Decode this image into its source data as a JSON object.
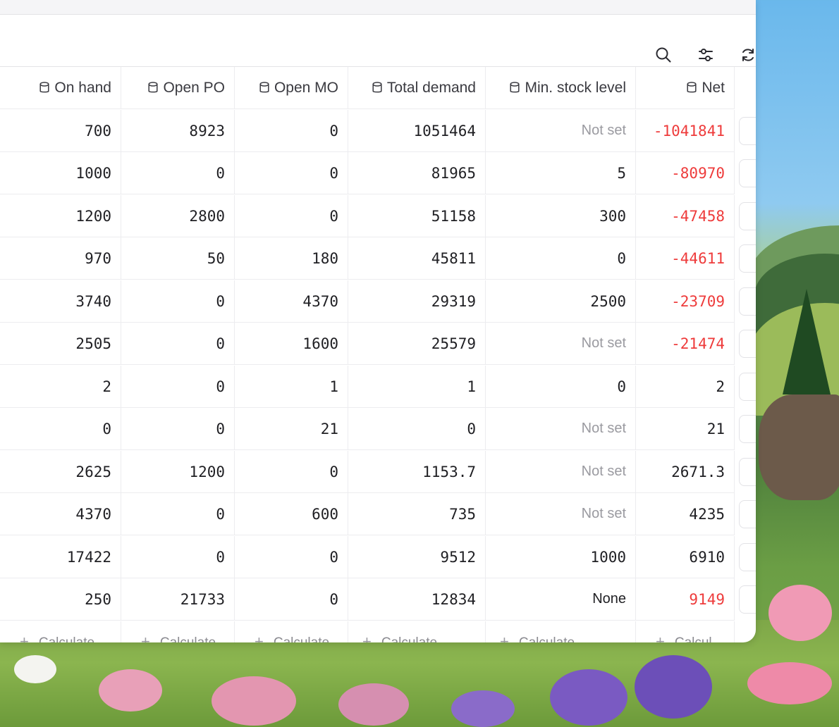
{
  "toolbar": {
    "icons": [
      "search-icon",
      "filter-settings-icon",
      "refresh-icon"
    ]
  },
  "columns": [
    {
      "key": "on_hand",
      "label": "On hand",
      "icon": "database-icon"
    },
    {
      "key": "open_po",
      "label": "Open PO",
      "icon": "database-icon"
    },
    {
      "key": "open_mo",
      "label": "Open MO",
      "icon": "database-icon"
    },
    {
      "key": "total_demand",
      "label": "Total demand",
      "icon": "database-icon"
    },
    {
      "key": "min_stock",
      "label": "Min. stock level",
      "icon": "database-icon"
    },
    {
      "key": "net",
      "label": "Net",
      "icon": "database-icon"
    }
  ],
  "rows": [
    {
      "on_hand": "700",
      "open_po": "8923",
      "open_mo": "0",
      "total_demand": "1051464",
      "min_stock": "Not set",
      "net": "-1041841"
    },
    {
      "on_hand": "1000",
      "open_po": "0",
      "open_mo": "0",
      "total_demand": "81965",
      "min_stock": "5",
      "net": "-80970"
    },
    {
      "on_hand": "1200",
      "open_po": "2800",
      "open_mo": "0",
      "total_demand": "51158",
      "min_stock": "300",
      "net": "-47458"
    },
    {
      "on_hand": "970",
      "open_po": "50",
      "open_mo": "180",
      "total_demand": "45811",
      "min_stock": "0",
      "net": "-44611"
    },
    {
      "on_hand": "3740",
      "open_po": "0",
      "open_mo": "4370",
      "total_demand": "29319",
      "min_stock": "2500",
      "net": "-23709"
    },
    {
      "on_hand": "2505",
      "open_po": "0",
      "open_mo": "1600",
      "total_demand": "25579",
      "min_stock": "Not set",
      "net": "-21474"
    },
    {
      "on_hand": "2",
      "open_po": "0",
      "open_mo": "1",
      "total_demand": "1",
      "min_stock": "0",
      "net": "2"
    },
    {
      "on_hand": "0",
      "open_po": "0",
      "open_mo": "21",
      "total_demand": "0",
      "min_stock": "Not set",
      "net": "21"
    },
    {
      "on_hand": "2625",
      "open_po": "1200",
      "open_mo": "0",
      "total_demand": "1153.7",
      "min_stock": "Not set",
      "net": "2671.3"
    },
    {
      "on_hand": "4370",
      "open_po": "0",
      "open_mo": "600",
      "total_demand": "735",
      "min_stock": "Not set",
      "net": "4235"
    },
    {
      "on_hand": "17422",
      "open_po": "0",
      "open_mo": "0",
      "total_demand": "9512",
      "min_stock": "1000",
      "net": "6910"
    },
    {
      "on_hand": "250",
      "open_po": "21733",
      "open_mo": "0",
      "total_demand": "12834",
      "min_stock": "None",
      "net": "9149"
    }
  ],
  "net_status": [
    "negative",
    "negative",
    "negative",
    "negative",
    "negative",
    "negative",
    "neutral",
    "neutral",
    "neutral",
    "neutral",
    "neutral",
    "negative"
  ],
  "footer": {
    "calc_labels": [
      "Calculate",
      "Calculate",
      "Calculate",
      "Calculate",
      "Calculate",
      "Calcul..."
    ],
    "plus": "+"
  },
  "colors": {
    "negative": "#ee3b3b",
    "muted": "#9a9aa0",
    "text": "#1f1f23"
  }
}
